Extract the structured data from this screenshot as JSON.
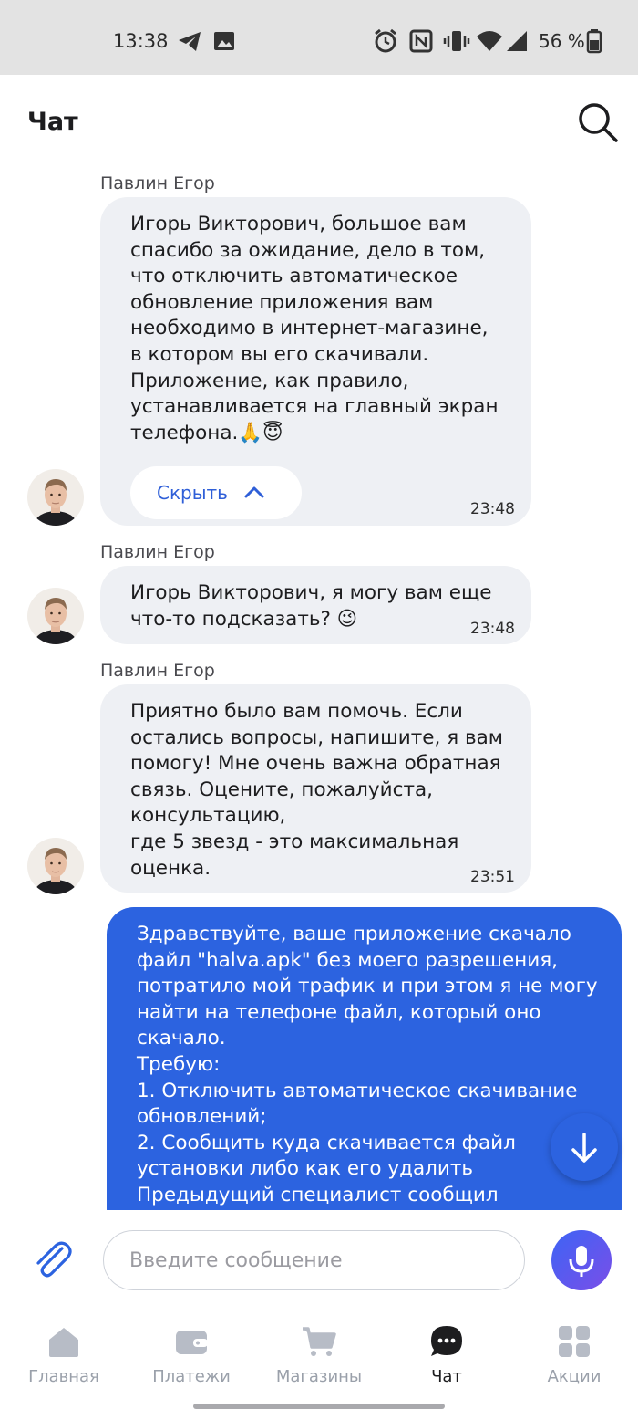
{
  "status_bar": {
    "time": "13:38",
    "battery": "56 %",
    "icons": [
      "telegram-icon",
      "image-icon",
      "alarm-icon",
      "nfc-icon",
      "vibrate-icon",
      "wifi-icon",
      "signal-icon",
      "battery-icon"
    ]
  },
  "header": {
    "title": "Чат",
    "search_icon": "search-icon"
  },
  "messages": [
    {
      "sender": "Павлин Егор",
      "text": "Игорь Викторович, большое вам спасибо за ожидание, дело в том, что отключить автоматическое обновление приложения вам необходимо в интернет-магазине, в котором вы его скачивали. Приложение, как правило, устанавливается на главный экран телефона.🙏😇",
      "time": "23:48",
      "collapse_label": "Скрыть"
    },
    {
      "sender": "Павлин Егор",
      "text": "Игорь Викторович, я могу вам еще что-то подсказать? 😉",
      "time": "23:48"
    },
    {
      "sender": "Павлин Егор",
      "text": "Приятно было вам помочь. Если остались вопросы, напишите, я вам помогу! Мне очень важна обратная связь. Оцените, пожалуйста, консультацию,\nгде 5 звезд - это максимальная оценка.",
      "time": "23:51"
    },
    {
      "sender": "",
      "text": "Здравствуйте, ваше приложение скачало файл \"halva.apk\" без моего разрешения, потратило мой трафик и при этом я не могу найти на телефоне файл, который оно скачало.\nТребую:\n1. Отключить автоматическое скачивание обновлений;\n2. Сообщить куда скачивается файл установки либо как его удалить\nПредыдущий специалист сообщил",
      "time": ""
    }
  ],
  "composer": {
    "placeholder": "Введите сообщение",
    "value": ""
  },
  "nav": [
    {
      "label": "Главная",
      "icon": "home-icon",
      "active": false
    },
    {
      "label": "Платежи",
      "icon": "wallet-icon",
      "active": false
    },
    {
      "label": "Магазины",
      "icon": "cart-icon",
      "active": false
    },
    {
      "label": "Чат",
      "icon": "chat-icon",
      "active": true
    },
    {
      "label": "Акции",
      "icon": "grid-icon",
      "active": false
    }
  ],
  "colors": {
    "accent": "#2c63e0",
    "incoming_bubble": "#eef0f4",
    "nav_inactive": "#9aa0aa",
    "status_bar_bg": "#e3e3e3"
  }
}
